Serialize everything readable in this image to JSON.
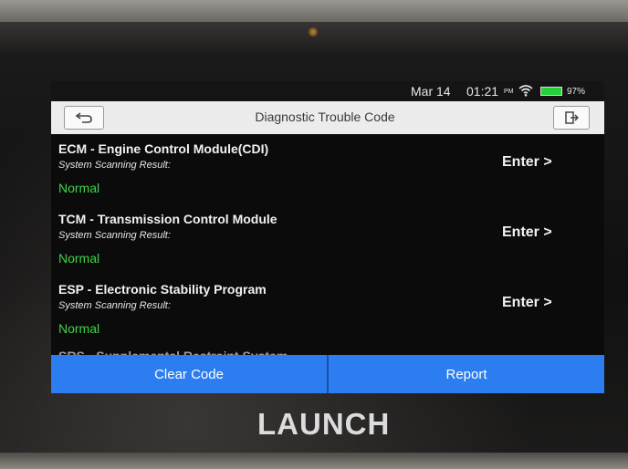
{
  "status_bar": {
    "date": "Mar 14",
    "time": "01:21",
    "ampm": "PM",
    "battery": "97%",
    "icons": [
      "wifi-icon",
      "battery-icon"
    ]
  },
  "header": {
    "title": "Diagnostic Trouble Code",
    "back_icon": "back-arrow-icon",
    "exit_icon": "exit-icon"
  },
  "systems": [
    {
      "name": "ECM - Engine Control Module(CDI)",
      "subtitle": "System Scanning Result:",
      "status": "Normal",
      "action": "Enter >"
    },
    {
      "name": "TCM - Transmission Control Module",
      "subtitle": "System Scanning Result:",
      "status": "Normal",
      "action": "Enter >"
    },
    {
      "name": "ESP - Electronic Stability Program",
      "subtitle": "System Scanning Result:",
      "status": "Normal",
      "action": "Enter >"
    },
    {
      "name": "SRS - Supplemental Restraint System"
    }
  ],
  "footer": {
    "clear_code": "Clear Code",
    "report": "Report"
  },
  "device": {
    "brand": "LAUNCH"
  },
  "colors": {
    "status_normal": "#3ed447",
    "button_blue": "#2c7df0",
    "battery": "#22d23a"
  }
}
